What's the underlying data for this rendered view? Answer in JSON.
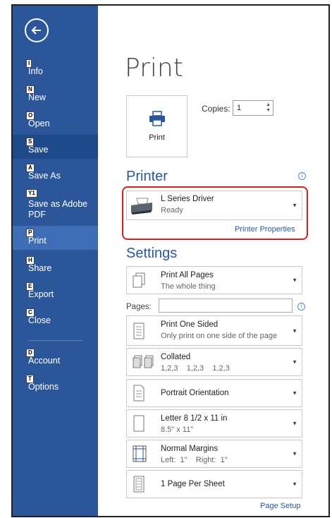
{
  "sidebar": {
    "items": [
      {
        "key": "I",
        "label": "Info"
      },
      {
        "key": "N",
        "label": "New"
      },
      {
        "key": "O",
        "label": "Open"
      },
      {
        "key": "S",
        "label": "Save"
      },
      {
        "key": "A",
        "label": "Save As"
      },
      {
        "key": "Y1",
        "label": "Save as Adobe PDF"
      },
      {
        "key": "P",
        "label": "Print"
      },
      {
        "key": "H",
        "label": "Share"
      },
      {
        "key": "E",
        "label": "Export"
      },
      {
        "key": "C",
        "label": "Close"
      },
      {
        "key": "D",
        "label": "Account"
      },
      {
        "key": "T",
        "label": "Options"
      }
    ],
    "active": "Print"
  },
  "main": {
    "title": "Print",
    "print_button_label": "Print",
    "copies_label": "Copies:",
    "copies_value": "1",
    "printer_heading": "Printer",
    "printer": {
      "name": "L Series Driver",
      "status": "Ready"
    },
    "printer_properties": "Printer Properties",
    "settings_heading": "Settings",
    "pages_label": "Pages:",
    "pages_value": "",
    "settings": [
      {
        "line1": "Print All Pages",
        "line2": "The whole thing",
        "icon": "pages-icon"
      },
      {
        "line1": "Print One Sided",
        "line2": "Only print on one side of the page",
        "icon": "one-sided-icon"
      },
      {
        "line1": "Collated",
        "line2": "1,2,3    1,2,3    1,2,3",
        "icon": "collated-icon"
      },
      {
        "line1": "Portrait Orientation",
        "line2": "",
        "icon": "portrait-icon"
      },
      {
        "line1": "Letter 8 1/2 x 11 in",
        "line2": "8.5\" x 11\"",
        "icon": "paper-size-icon"
      },
      {
        "line1": "Normal Margins",
        "line2": "Left:  1\"    Right:  1\"",
        "icon": "margins-icon"
      },
      {
        "line1": "1 Page Per Sheet",
        "line2": "",
        "icon": "pages-per-sheet-icon"
      }
    ],
    "page_setup": "Page Setup"
  },
  "colors": {
    "sidebar": "#2b579a",
    "active": "#3e6db5",
    "accent": "#2b579a",
    "highlight": "#d91c1c"
  }
}
